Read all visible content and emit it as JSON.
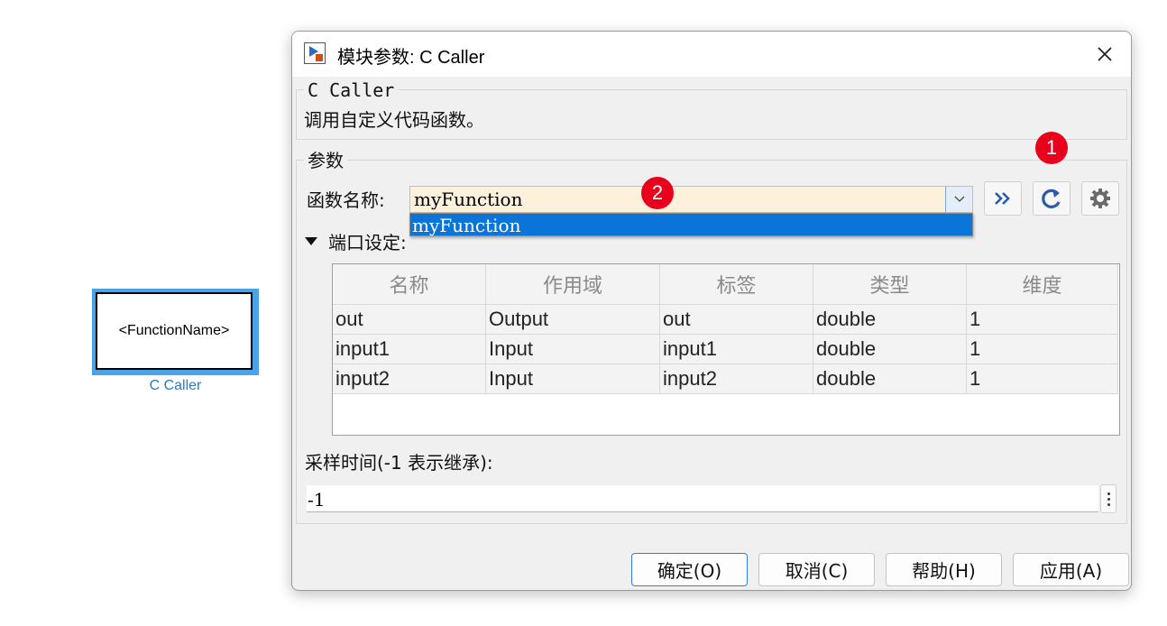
{
  "canvas": {
    "block_text": "<FunctionName>",
    "block_label": "C Caller"
  },
  "dialog": {
    "title": "模块参数: C Caller",
    "close_icon": "close-icon",
    "block_section": {
      "legend": "C Caller",
      "description": "调用自定义代码函数。"
    },
    "params_section": {
      "legend": "参数",
      "function_label": "函数名称:",
      "function_value": "myFunction",
      "dropdown_options": [
        "myFunction"
      ],
      "selected_option": "myFunction",
      "tool_buttons": [
        "double-chevron-right-icon",
        "refresh-icon",
        "gear-icon"
      ],
      "port_settings_label": "端口设定:",
      "table": {
        "headers": [
          "名称",
          "作用域",
          "标签",
          "类型",
          "维度"
        ],
        "rows": [
          [
            "out",
            "Output",
            "out",
            "double",
            "1"
          ],
          [
            "input1",
            "Input",
            "input1",
            "double",
            "1"
          ],
          [
            "input2",
            "Input",
            "input2",
            "double",
            "1"
          ]
        ]
      },
      "sample_time_label": "采样时间(-1 表示继承):",
      "sample_time_value": "-1"
    },
    "badges": {
      "one": "1",
      "two": "2"
    },
    "buttons": {
      "ok": "确定(O)",
      "cancel": "取消(C)",
      "help": "帮助(H)",
      "apply": "应用(A)"
    }
  },
  "colors": {
    "accent": "#0a74d9",
    "badge": "#e8001c",
    "block_label": "#1a7fd4",
    "combo_bg": "#fdf1dc"
  }
}
